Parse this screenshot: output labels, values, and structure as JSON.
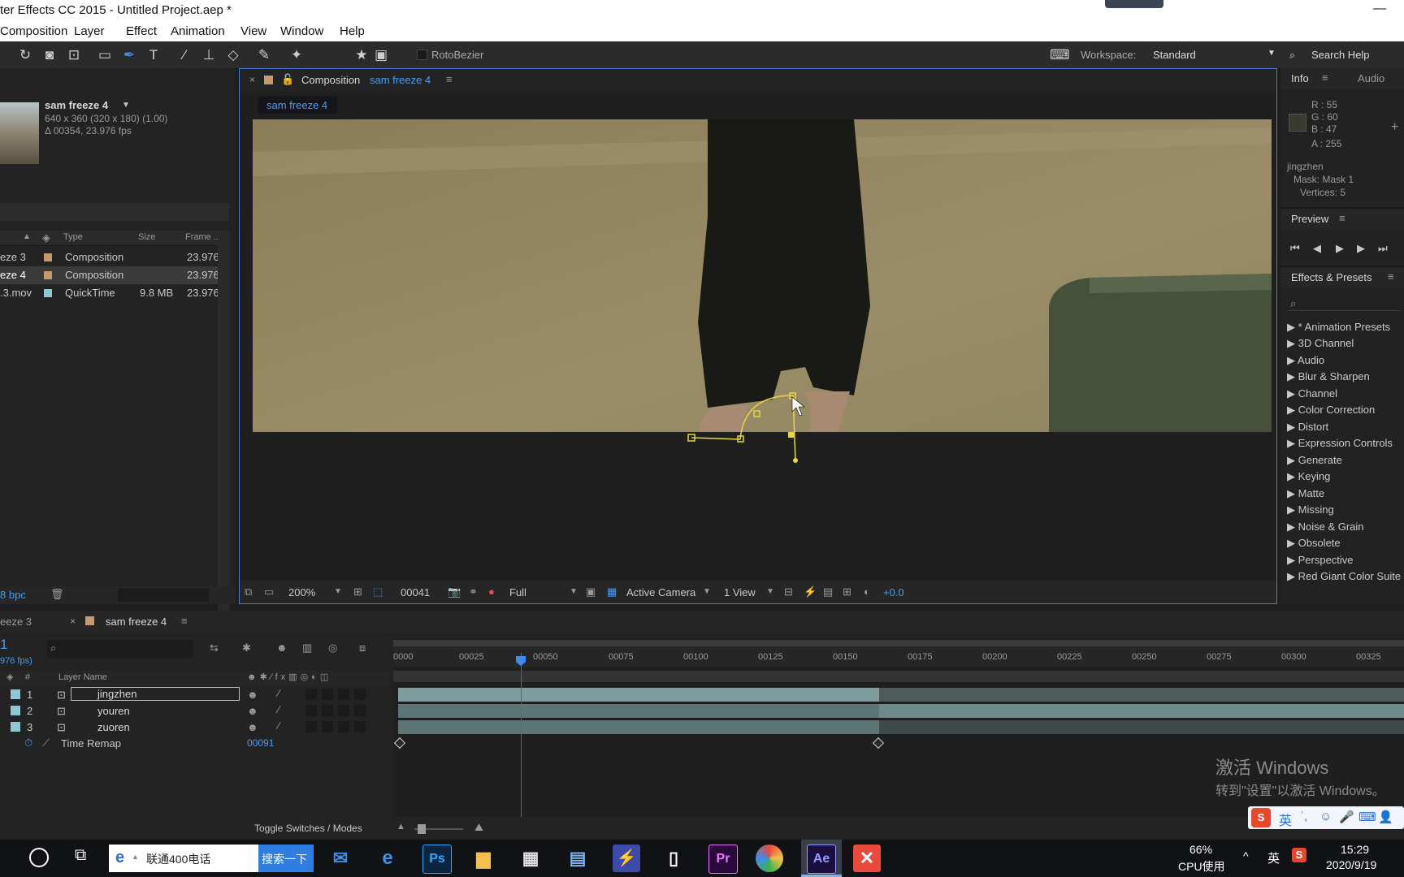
{
  "window": {
    "title": "ter Effects CC 2015 - Untitled Project.aep *",
    "minimize_glyph": "—"
  },
  "menu": [
    "Composition",
    "Layer",
    "Effect",
    "Animation",
    "View",
    "Window",
    "Help"
  ],
  "toolbar": {
    "rotobezier_label": "RotoBezier",
    "workspace_label": "Workspace:",
    "workspace_value": "Standard",
    "search_help": "Search Help"
  },
  "project": {
    "item_name": "sam freeze 4",
    "item_dims": "640 x 360  (320 x 180) (1.00)",
    "item_duration": "Δ 00354, 23.976 fps",
    "columns": [
      "Type",
      "Size",
      "Frame ..."
    ],
    "rows": [
      {
        "name": "eze 3",
        "type": "Composition",
        "size": "",
        "fps": "23.976",
        "color": "#c69a6d"
      },
      {
        "name": "eze 4",
        "type": "Composition",
        "size": "",
        "fps": "23.976",
        "color": "#c69a6d"
      },
      {
        "name": ".3.mov",
        "type": "QuickTime",
        "size": "9.8 MB",
        "fps": "23.976",
        "color": "#8fc7d4"
      }
    ],
    "bpc": "8 bpc"
  },
  "composition": {
    "panel_label": "Composition",
    "comp_name": "sam freeze 4",
    "tab": "sam freeze 4",
    "zoom": "200%",
    "frame": "00041",
    "resolution": "Full",
    "camera": "Active Camera",
    "views": "1 View",
    "exposure": "+0.0"
  },
  "info": {
    "tab_info": "Info",
    "tab_audio": "Audio",
    "r": "R : 55",
    "g": "G : 60",
    "b": "B : 47",
    "a": "A : 255",
    "sample_color": "#373c2f",
    "layer": "jingzhen",
    "mask": "Mask: Mask 1",
    "vertices": "Vertices: 5"
  },
  "preview": {
    "title": "Preview"
  },
  "effects": {
    "title": "Effects & Presets",
    "items": [
      "* Animation Presets",
      "3D Channel",
      "Audio",
      "Blur & Sharpen",
      "Channel",
      "Color Correction",
      "Distort",
      "Expression Controls",
      "Generate",
      "Keying",
      "Matte",
      "Missing",
      "Noise & Grain",
      "Obsolete",
      "Perspective",
      "Red Giant Color Suite"
    ]
  },
  "timeline": {
    "tab_prev": "eeze 3",
    "tab_active": "sam freeze 4",
    "current_time": "1",
    "fps_note": "976 fps)",
    "column_layer": "Layer Name",
    "column_num": "#",
    "ruler": [
      "0000",
      "00025",
      "00050",
      "00075",
      "00100",
      "00125",
      "00150",
      "00175",
      "00200",
      "00225",
      "00250",
      "00275",
      "00300",
      "00325"
    ],
    "layers": [
      {
        "num": "1",
        "name": "jingzhen"
      },
      {
        "num": "2",
        "name": "youren"
      },
      {
        "num": "3",
        "name": "zuoren"
      }
    ],
    "time_remap_label": "Time Remap",
    "time_remap_value": "00091",
    "toggle_label": "Toggle Switches / Modes"
  },
  "watermark": {
    "line1": "激活 Windows",
    "line2": "转到\"设置\"以激活 Windows。"
  },
  "taskbar": {
    "search_text": "联通400电话",
    "search_button": "搜索一下",
    "cpu_percent": "66%",
    "cpu_label": "CPU使用",
    "ime": "英",
    "time": "15:29",
    "date": "2020/9/19",
    "apps": [
      "Ps",
      "Pr",
      "Ae"
    ],
    "ime_bar": "英"
  }
}
